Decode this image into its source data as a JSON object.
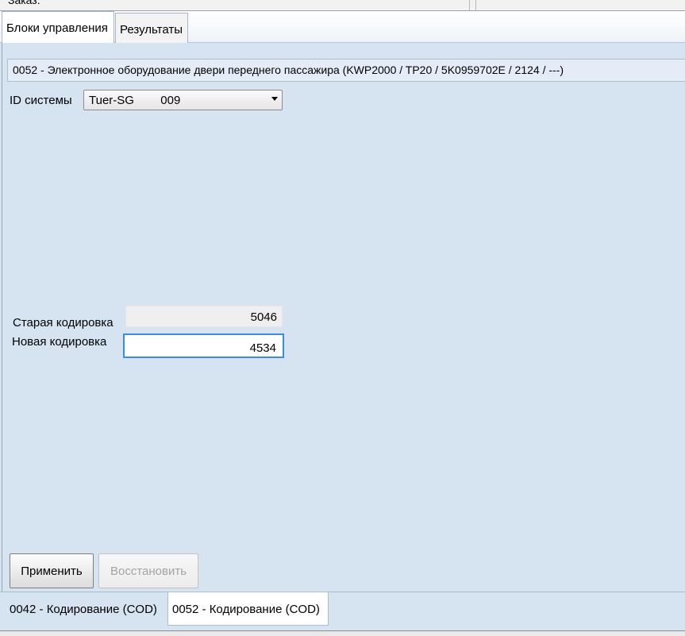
{
  "top": {
    "order_label": "Заказ:"
  },
  "tabs": [
    {
      "label": "Блоки управления"
    },
    {
      "label": "Результаты"
    }
  ],
  "header": {
    "text": "0052 - Электронное оборудование двери переднего пассажира  (KWP2000 / TP20 / 5K0959702E / 2124 / ---)"
  },
  "system_id": {
    "label": "ID системы",
    "selected": "Tuer-SG        009"
  },
  "coding": {
    "old_label": "Старая кодировка",
    "old_value": "5046",
    "new_label": "Новая кодировка",
    "new_value": "4534"
  },
  "buttons": {
    "apply": "Применить",
    "restore": "Восстановить"
  },
  "bottom_tabs": [
    {
      "label": "0042 - Кодирование (COD)"
    },
    {
      "label": "0052 - Кодирование (COD)"
    }
  ]
}
